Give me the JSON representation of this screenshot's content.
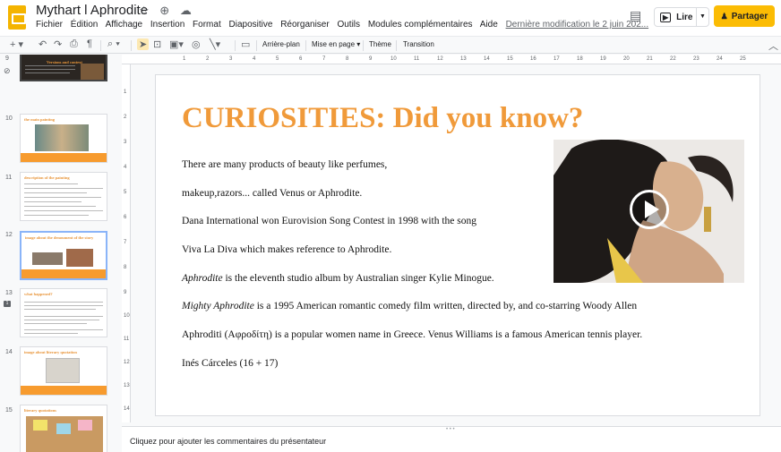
{
  "app": {
    "title": "Mythart l Aphrodite",
    "star_icon": "star-icon",
    "move_icon": "move-to-folder-icon",
    "cloud_icon": "cloud-status-icon"
  },
  "menu": [
    "Fichier",
    "Édition",
    "Affichage",
    "Insertion",
    "Format",
    "Diapositive",
    "Réorganiser",
    "Outils",
    "Modules complémentaires",
    "Aide"
  ],
  "last_modified": "Dernière modification le 2 juin 202...",
  "header": {
    "read_label": "Lire",
    "share_label": "Partager",
    "accent": "#fbbc04"
  },
  "toolbar": {
    "background_label": "Arrière-plan",
    "layout_label": "Mise en page",
    "theme_label": "Thème",
    "transition_label": "Transition"
  },
  "filmstrip": {
    "slides": [
      {
        "num": "9",
        "title": "Versions and context"
      },
      {
        "num": "10",
        "title": "the main painting"
      },
      {
        "num": "11",
        "title": "description of the painting"
      },
      {
        "num": "12",
        "title": "image about the denoument   of the story"
      },
      {
        "num": "13",
        "title": "what happened?"
      },
      {
        "num": "14",
        "title": "image about literary quotation"
      },
      {
        "num": "15",
        "title": "literary quotations"
      }
    ]
  },
  "ruler": {
    "h": [
      "1",
      "2",
      "3",
      "4",
      "5",
      "6",
      "7",
      "8",
      "9",
      "10",
      "11",
      "12",
      "13",
      "14",
      "15",
      "16",
      "17",
      "18",
      "19",
      "20",
      "21",
      "22",
      "23",
      "24",
      "25"
    ],
    "v": [
      "1",
      "2",
      "3",
      "4",
      "5",
      "6",
      "7",
      "8",
      "9",
      "10",
      "11",
      "12",
      "13",
      "14"
    ]
  },
  "slide": {
    "title": "CURIOSITIES: Did you know?",
    "lines": [
      {
        "text": "There are many products of beauty like  perfumes,"
      },
      {
        "text": "makeup,razors... called Venus or Aphrodite."
      },
      {
        "text": "Dana International won Eurovision Song Contest  in 1998 with the song"
      },
      {
        "text": "Viva La Diva which makes reference to Aphrodite."
      },
      {
        "italic": "Aphrodite",
        "text": " is the eleventh studio album by Australian singer Kylie Minogue."
      },
      {
        "italic": "Mighty Aphrodite",
        "text": " is a 1995 American romantic comedy film written, directed by, and co-starring Woody  Allen"
      },
      {
        "text": "Aphroditi (Αφροδίτη) is a popular women name in Greece. Venus  Williams is a famous American tennis player."
      },
      {
        "text": "Inés Cárceles (16 + 17)"
      }
    ],
    "title_color": "#f09a3a"
  },
  "notes": {
    "placeholder": "Cliquez pour ajouter les commentaires du présentateur"
  }
}
